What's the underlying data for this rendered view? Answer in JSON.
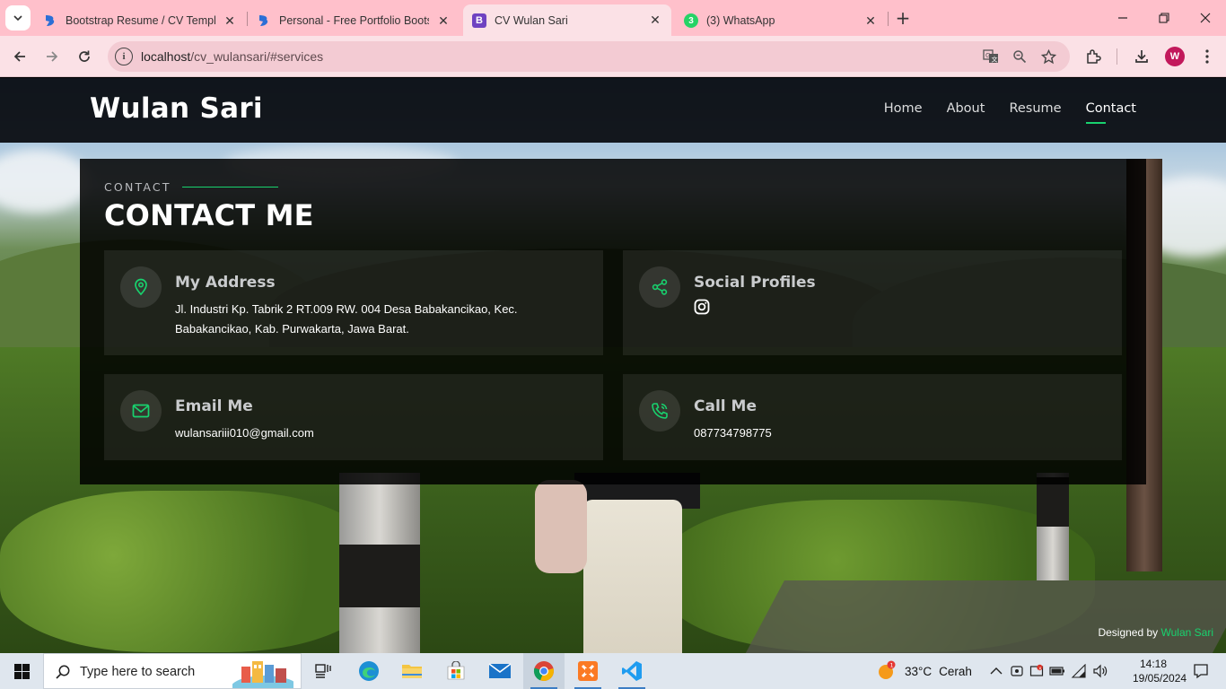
{
  "browser": {
    "tabs": [
      {
        "title": "Bootstrap Resume / CV Templat",
        "favicon": "bootstrap-b-icon"
      },
      {
        "title": "Personal - Free Portfolio Bootst",
        "favicon": "bootstrap-b-icon"
      },
      {
        "title": "CV Wulan Sari",
        "favicon": "bootstrap-icon",
        "active": true
      },
      {
        "title": "(3) WhatsApp",
        "favicon": "whatsapp-icon",
        "badge": "3"
      }
    ],
    "url_host": "localhost",
    "url_path": "/cv_wulansari/#services",
    "profile_initial": "W"
  },
  "site": {
    "brand": "Wulan Sari",
    "nav": [
      "Home",
      "About",
      "Resume",
      "Contact"
    ],
    "active_nav": "Contact",
    "accent": "#18d26e"
  },
  "contact": {
    "subtitle": "CONTACT",
    "title": "CONTACT ME",
    "address": {
      "heading": "My Address",
      "text": "Jl. Industri Kp. Tabrik 2 RT.009 RW. 004 Desa Babakancikao, Kec. Babakancikao, Kab. Purwakarta, Jawa Barat."
    },
    "social": {
      "heading": "Social Profiles",
      "icon": "instagram-icon"
    },
    "email": {
      "heading": "Email Me",
      "text": "wulansariii010@gmail.com"
    },
    "phone": {
      "heading": "Call Me",
      "text": "087734798775"
    }
  },
  "footer": {
    "credits_prefix": "Designed by",
    "credits_name": "Wulan Sari"
  },
  "taskbar": {
    "search_placeholder": "Type here to search",
    "weather_temp": "33°C",
    "weather_text": "Cerah",
    "time": "14:18",
    "date": "19/05/2024"
  }
}
